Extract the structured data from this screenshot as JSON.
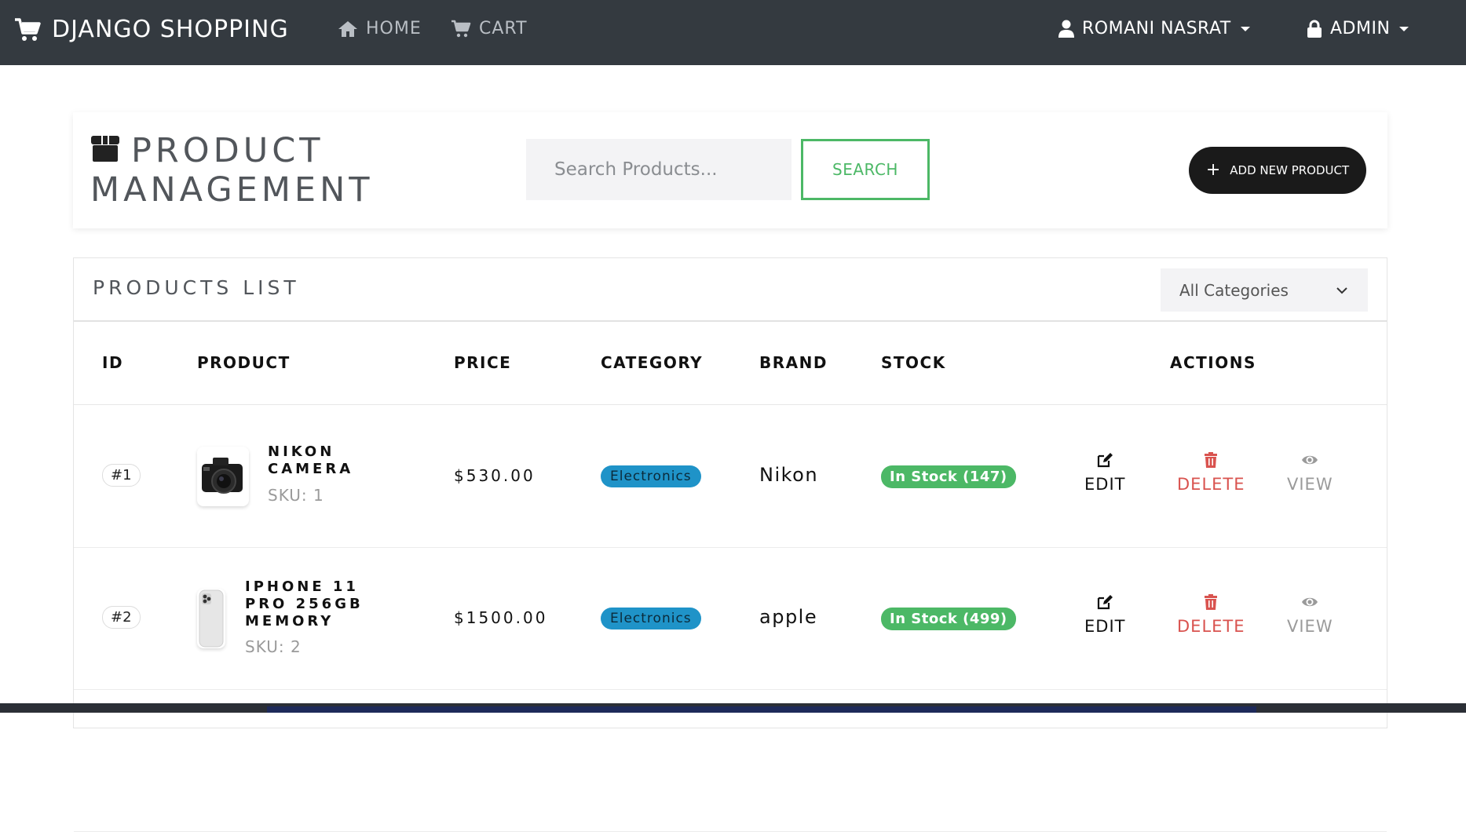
{
  "navbar": {
    "brand": "DJANGO SHOPPING",
    "links": [
      {
        "label": "HOME",
        "icon": "home-icon"
      },
      {
        "label": "CART",
        "icon": "cart-icon"
      }
    ],
    "user": {
      "label": "ROMANI NASRAT",
      "icon": "user-icon"
    },
    "admin": {
      "label": "ADMIN",
      "icon": "lock-icon"
    }
  },
  "header": {
    "title_line1": "PRODUCT",
    "title_line2": "MANAGEMENT",
    "search": {
      "placeholder": "Search Products...",
      "value": ""
    },
    "search_button": "SEARCH",
    "add_button": "ADD NEW PRODUCT"
  },
  "products": {
    "list_title": "PRODUCTS LIST",
    "category_filter": "All Categories",
    "columns": [
      "ID",
      "PRODUCT",
      "PRICE",
      "CATEGORY",
      "BRAND",
      "STOCK",
      "ACTIONS"
    ],
    "rows": [
      {
        "id": "#1",
        "name_line1": "NIKON",
        "name_line2": "CAMERA",
        "name_line3": "",
        "sku": "SKU: 1",
        "price": "$530.00",
        "category": "Electronics",
        "brand": "Nikon",
        "stock": "In Stock (147)"
      },
      {
        "id": "#2",
        "name_line1": "IPHONE 11",
        "name_line2": "PRO 256GB",
        "name_line3": "MEMORY",
        "sku": "SKU: 2",
        "price": "$1500.00",
        "category": "Electronics",
        "brand": "apple",
        "stock": "In Stock (499)"
      }
    ],
    "actions": {
      "edit": "EDIT",
      "delete": "DELETE",
      "view": "VIEW"
    }
  },
  "colors": {
    "navbar": "#343a40",
    "success": "#4cb866",
    "info": "#1f93c8",
    "danger": "#d9534f",
    "dark_button": "#1a1a1a"
  }
}
